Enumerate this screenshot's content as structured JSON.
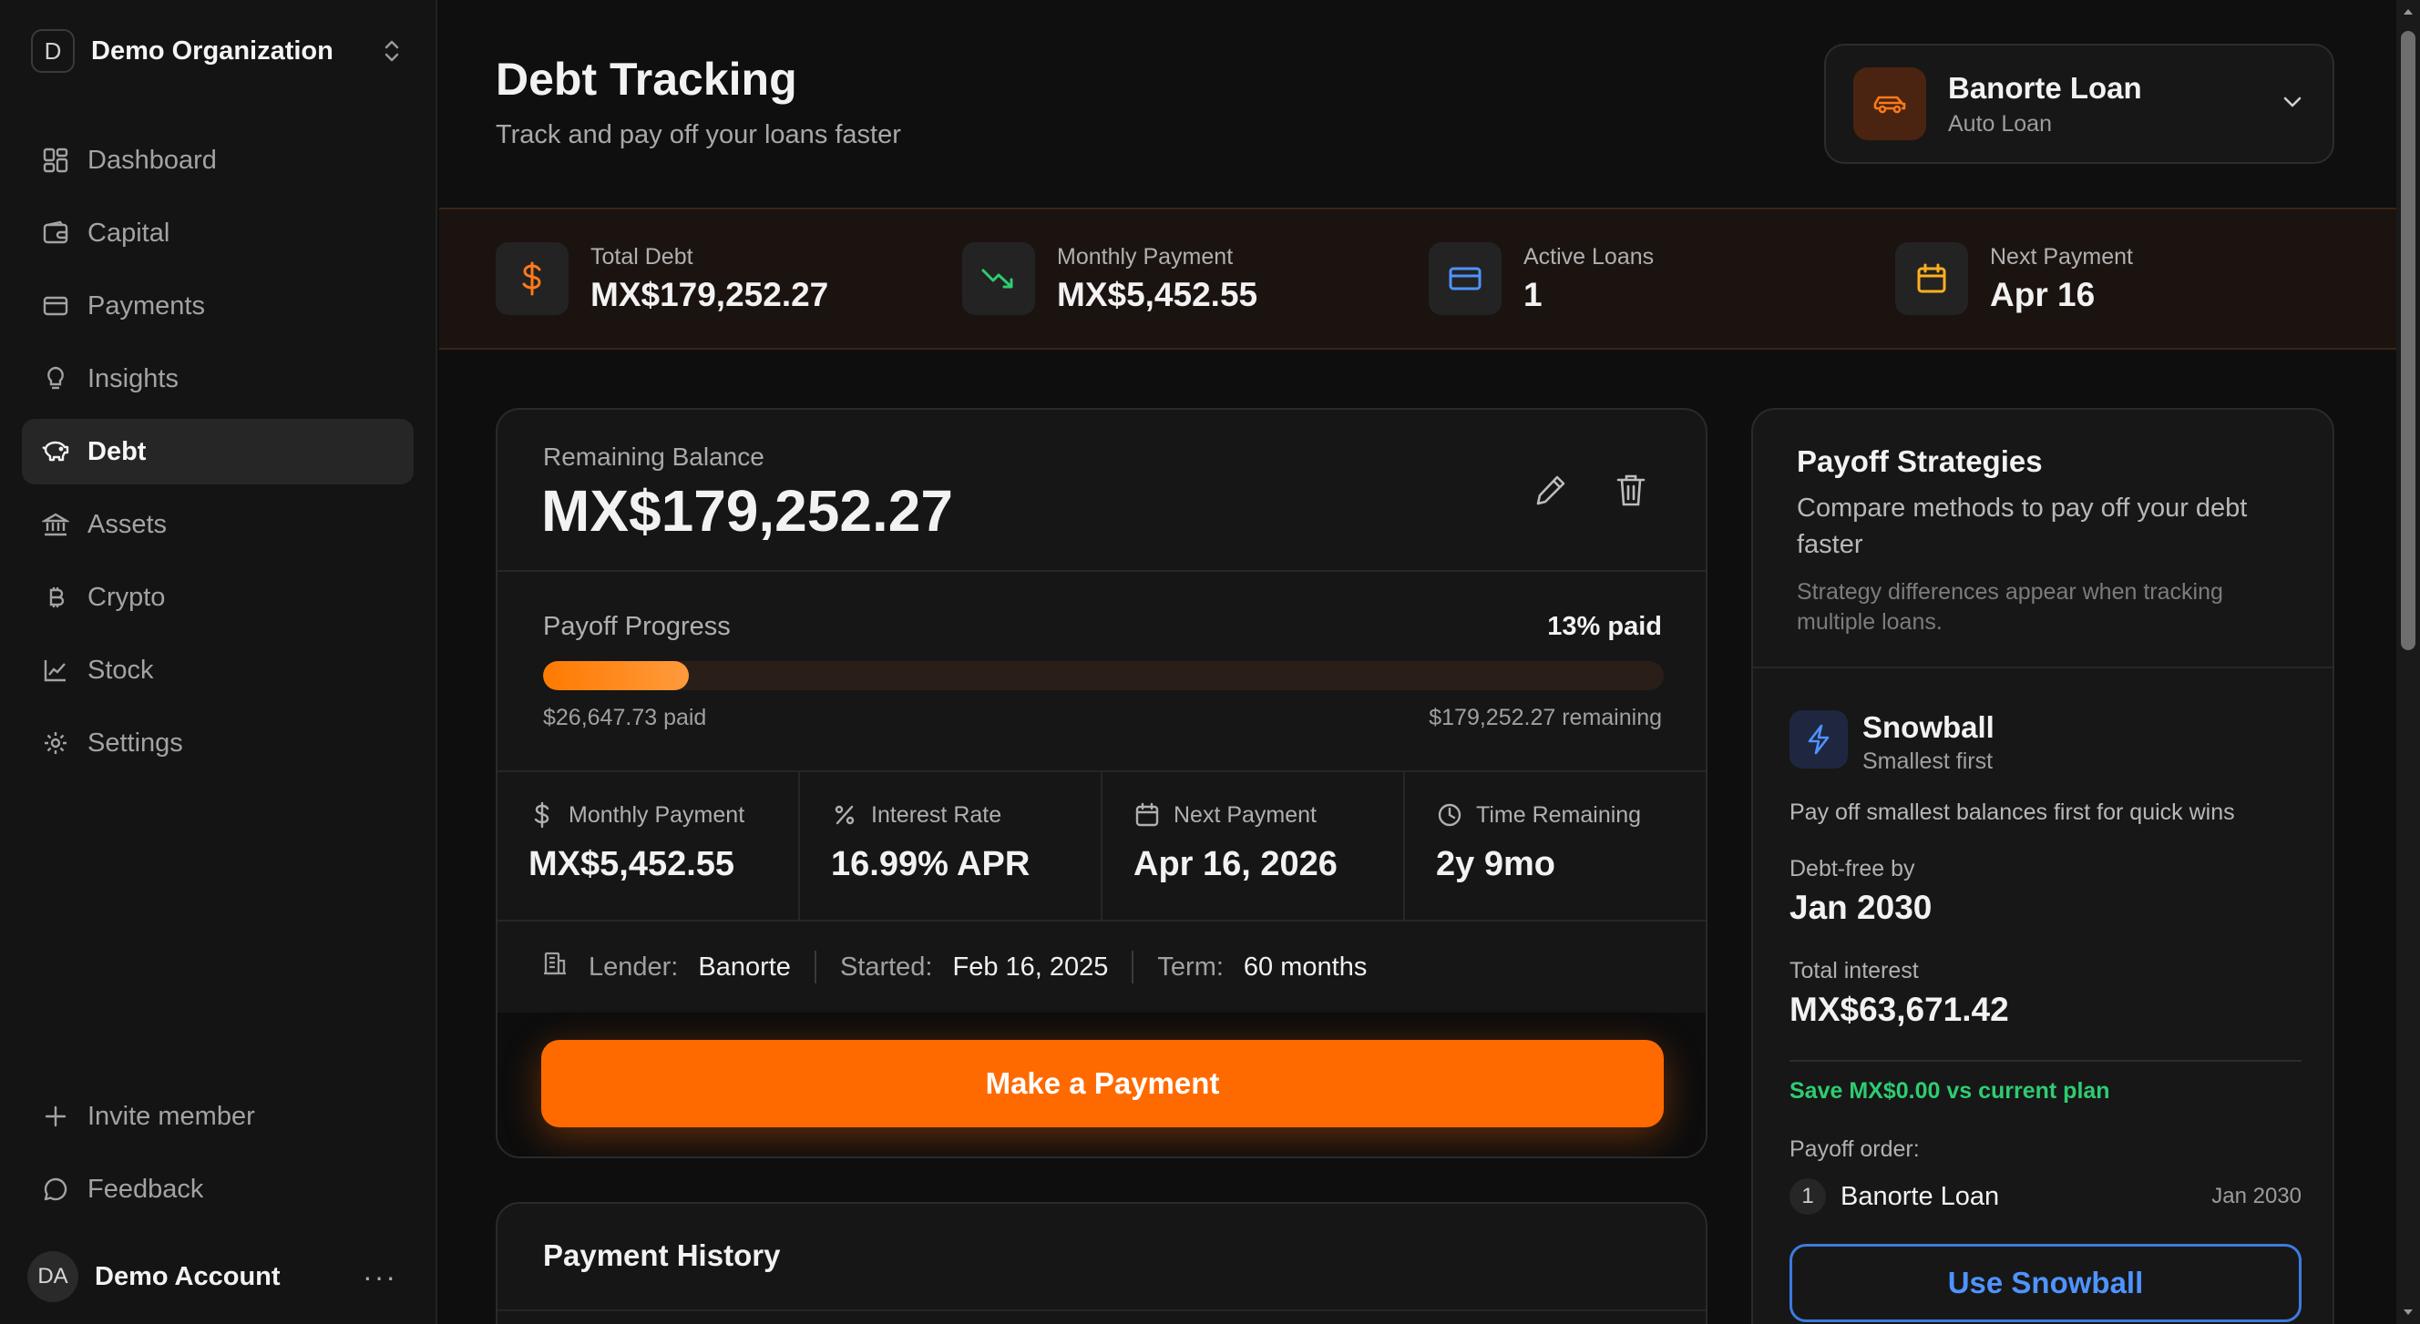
{
  "org": {
    "initial": "D",
    "name": "Demo Organization"
  },
  "nav": [
    {
      "label": "Dashboard",
      "icon": "dashboard-icon"
    },
    {
      "label": "Capital",
      "icon": "wallet-icon"
    },
    {
      "label": "Payments",
      "icon": "credit-card-icon"
    },
    {
      "label": "Insights",
      "icon": "lightbulb-icon"
    },
    {
      "label": "Debt",
      "icon": "piggy-bank-icon",
      "active": true
    },
    {
      "label": "Assets",
      "icon": "bank-icon"
    },
    {
      "label": "Crypto",
      "icon": "bitcoin-icon"
    },
    {
      "label": "Stock",
      "icon": "chart-line-icon"
    },
    {
      "label": "Settings",
      "icon": "gear-icon"
    }
  ],
  "nav_bottom": {
    "invite": "Invite member",
    "feedback": "Feedback"
  },
  "account": {
    "initials": "DA",
    "name": "Demo Account",
    "more": "···"
  },
  "header": {
    "title": "Debt Tracking",
    "subtitle": "Track and pay off your loans faster"
  },
  "loan_selector": {
    "name": "Banorte Loan",
    "type": "Auto Loan"
  },
  "stats": [
    {
      "label": "Total Debt",
      "value": "MX$179,252.27",
      "icon": "dollar-icon",
      "color": "#ff7a1a"
    },
    {
      "label": "Monthly Payment",
      "value": "MX$5,452.55",
      "icon": "trending-down-icon",
      "color": "#2ecc71"
    },
    {
      "label": "Active Loans",
      "value": "1",
      "icon": "credit-card-icon",
      "color": "#4f93ff"
    },
    {
      "label": "Next Payment",
      "value": "Apr 16",
      "icon": "calendar-icon",
      "color": "#ffb020"
    }
  ],
  "loan": {
    "balance_label": "Remaining Balance",
    "balance": "MX$179,252.27",
    "progress_label": "Payoff Progress",
    "progress_pct_text": "13% paid",
    "progress_fraction": 0.13,
    "paid_text": "$26,647.73 paid",
    "remaining_text": "$179,252.27 remaining",
    "metrics": [
      {
        "label": "Monthly Payment",
        "value": "MX$5,452.55",
        "icon": "dollar-icon"
      },
      {
        "label": "Interest Rate",
        "value": "16.99% APR",
        "icon": "percent-icon"
      },
      {
        "label": "Next Payment",
        "value": "Apr 16, 2026",
        "icon": "calendar-icon"
      },
      {
        "label": "Time Remaining",
        "value": "2y 9mo",
        "icon": "clock-icon"
      }
    ],
    "lender_label": "Lender:",
    "lender": "Banorte",
    "started_label": "Started:",
    "started": "Feb 16, 2025",
    "term_label": "Term:",
    "term": "60 months",
    "pay_button": "Make a Payment"
  },
  "history": {
    "title": "Payment History"
  },
  "strategies": {
    "title": "Payoff Strategies",
    "description": "Compare methods to pay off your debt faster",
    "note": "Strategy differences appear when tracking multiple loans.",
    "snowball": {
      "name": "Snowball",
      "subtitle": "Smallest first",
      "description": "Pay off smallest balances first for quick wins",
      "debt_free_label": "Debt-free by",
      "debt_free": "Jan 2030",
      "interest_label": "Total interest",
      "interest": "MX$63,671.42",
      "save_text": "Save MX$0.00 vs current plan",
      "order_label": "Payoff order:",
      "order": [
        {
          "num": "1",
          "name": "Banorte Loan",
          "date": "Jan 2030"
        }
      ],
      "button": "Use Snowball"
    }
  },
  "colors": {
    "accent": "#ff6a00",
    "blue": "#4f93ff",
    "green": "#2ecc71"
  }
}
